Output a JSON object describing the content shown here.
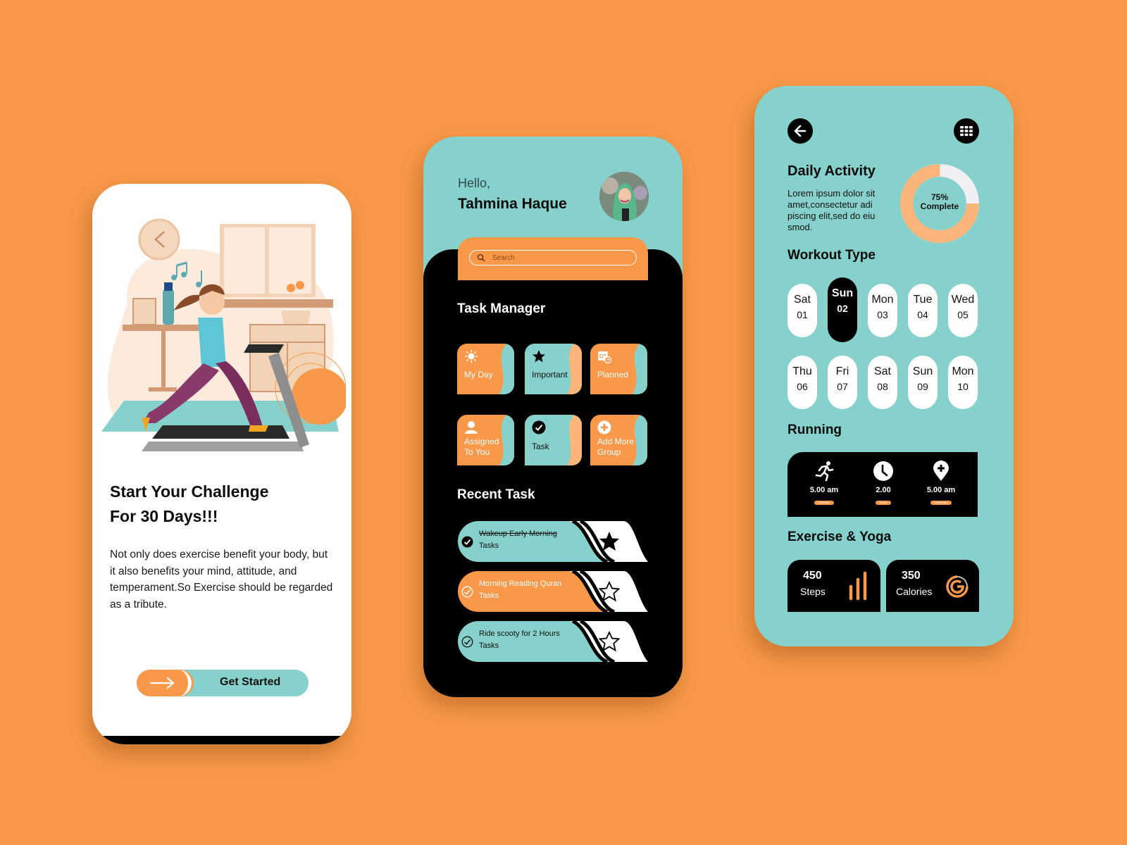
{
  "colors": {
    "background": "#F99848",
    "orange": "#F99848",
    "teal": "#86D1CB",
    "black": "#000000",
    "white": "#FFFFFF",
    "light_orange": "#FBB57A"
  },
  "onboarding": {
    "title_line1": "Start Your Challenge",
    "title_line2": "For 30 Days!!!",
    "body": "Not only does exercise benefit your body, but it also benefits your mind, attitude, and temperament.So Exercise should be regarded as a tribute.",
    "cta_label": "Get Started",
    "cta_icon": "arrow-right-icon",
    "illustration": "woman-running-on-treadmill"
  },
  "task_manager": {
    "greeting": "Hello,",
    "user_name": "Tahmina Haque",
    "avatar_alt": "user-avatar",
    "search_placeholder": "Search",
    "section_title": "Task Manager",
    "tiles": [
      {
        "label": "My Day",
        "icon": "sun-icon",
        "theme": "orange"
      },
      {
        "label": "Important",
        "icon": "star-icon",
        "theme": "teal"
      },
      {
        "label": "Planned",
        "icon": "calendar-clock-icon",
        "theme": "orange"
      },
      {
        "label_line1": "Assigned",
        "label_line2": "To You",
        "icon": "user-icon",
        "theme": "orange"
      },
      {
        "label": "Task",
        "icon": "check-circle-icon",
        "theme": "teal"
      },
      {
        "label_line1": "Add More",
        "label_line2": "Group",
        "icon": "plus-circle-icon",
        "theme": "orange"
      }
    ],
    "recent_title": "Recent Task",
    "recent_tasks": [
      {
        "name": "Wakeup Early Morning",
        "sub": "Tasks",
        "completed": true,
        "starred": true,
        "theme": "teal"
      },
      {
        "name": "Morning Reading Quran",
        "sub": "Tasks",
        "completed": false,
        "starred": false,
        "theme": "orange"
      },
      {
        "name": "Ride scooty for 2 Hours",
        "sub": "Tasks",
        "completed": false,
        "starred": false,
        "theme": "teal"
      }
    ]
  },
  "activity": {
    "back_icon": "arrow-left-icon",
    "menu_icon": "grid-menu-icon",
    "title": "Daily Activity",
    "description": "Lorem ipsum dolor sit amet,consectetur adi piscing elit,sed do eiu smod.",
    "progress_percent": 75,
    "progress_label_1": "75%",
    "progress_label_2": "Complete",
    "workout_title": "Workout Type",
    "days": [
      {
        "name": "Sat",
        "num": "01",
        "active": false
      },
      {
        "name": "Sun",
        "num": "02",
        "active": true
      },
      {
        "name": "Mon",
        "num": "03",
        "active": false
      },
      {
        "name": "Tue",
        "num": "04",
        "active": false
      },
      {
        "name": "Wed",
        "num": "05",
        "active": false
      },
      {
        "name": "Thu",
        "num": "06",
        "active": false
      },
      {
        "name": "Fri",
        "num": "07",
        "active": false
      },
      {
        "name": "Sat",
        "num": "08",
        "active": false
      },
      {
        "name": "Sun",
        "num": "09",
        "active": false
      },
      {
        "name": "Mon",
        "num": "10",
        "active": false
      }
    ],
    "running_title": "Running",
    "running_stats": [
      {
        "icon": "runner-icon",
        "value": "5.00 am",
        "unit": "Kilometer"
      },
      {
        "icon": "clock-icon",
        "value": "2.00",
        "unit": "Hours"
      },
      {
        "icon": "location-pin-icon",
        "value": "5.00 am",
        "unit": "Kilometers"
      }
    ],
    "exercise_title": "Exercise & Yoga",
    "exercise_cards": [
      {
        "value": "450",
        "label": "Steps",
        "icon": "bar-chart-icon"
      },
      {
        "value": "350",
        "label": "Calories",
        "icon": "calorie-gauge-icon"
      }
    ]
  }
}
